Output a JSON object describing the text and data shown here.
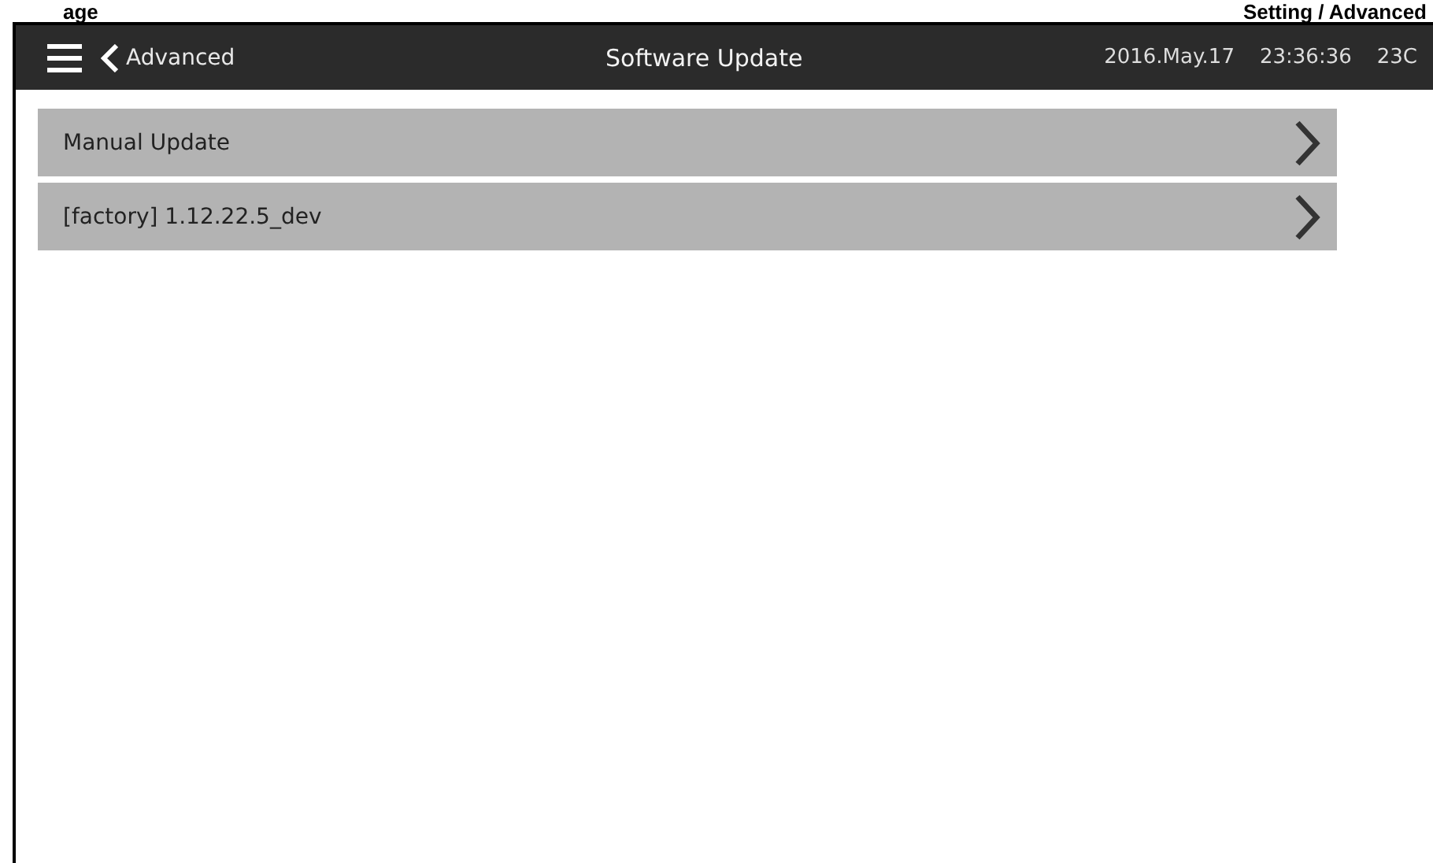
{
  "page_header": {
    "left": "age",
    "right": "Setting / Advanced"
  },
  "top_bar": {
    "back_label": "Advanced",
    "title": "Software Update",
    "date": "2016.May.17",
    "time": "23:36:36",
    "temperature": "23C"
  },
  "items": [
    {
      "label": "Manual Update"
    },
    {
      "label": "[factory] 1.12.22.5_dev"
    }
  ]
}
